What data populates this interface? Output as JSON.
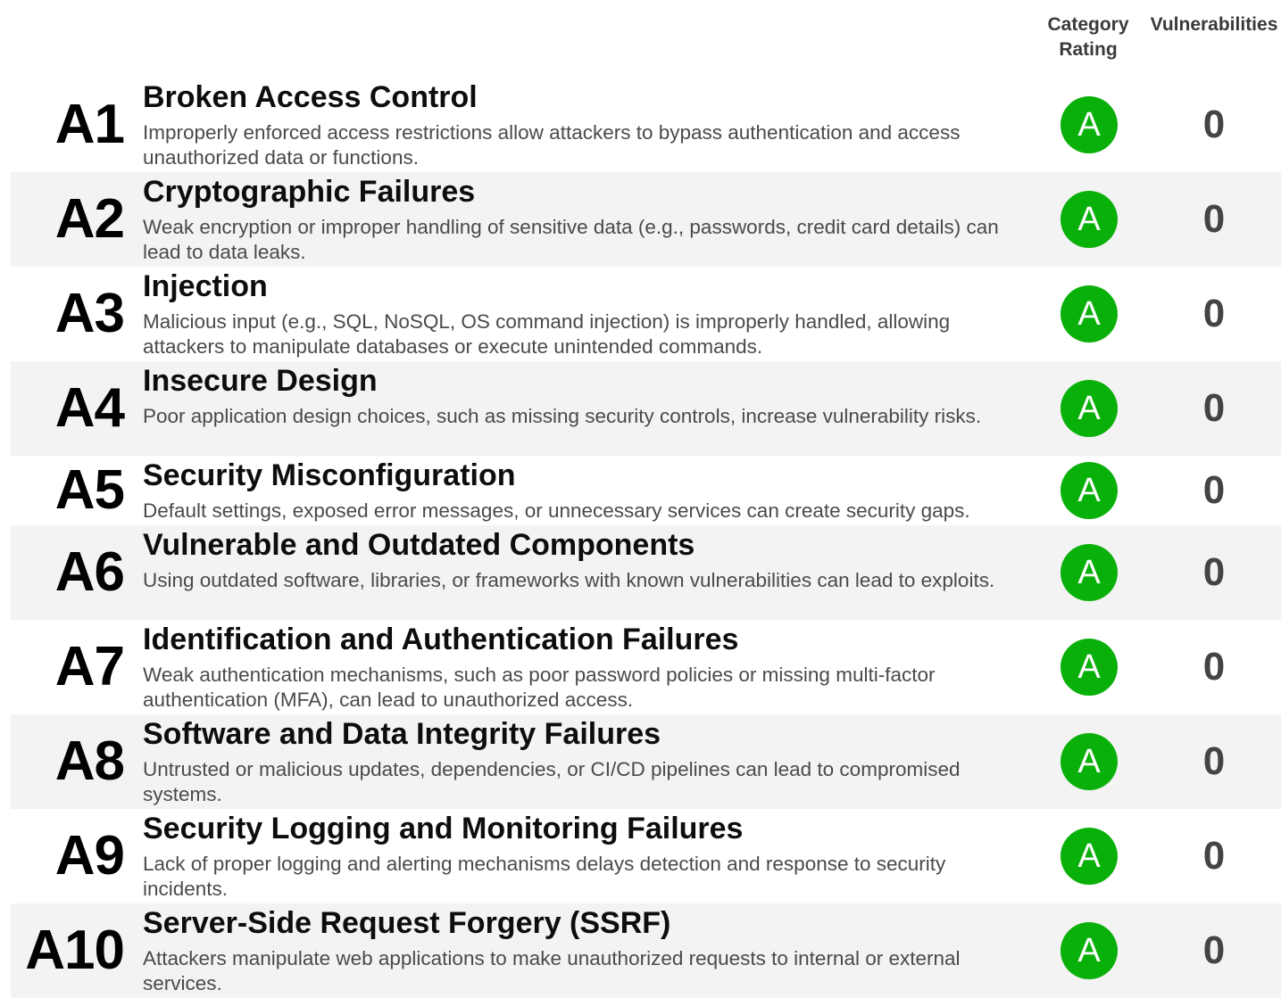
{
  "headers": {
    "rating": "Category\nRating",
    "vulnerabilities": "Vulnerabilities"
  },
  "colors": {
    "rating_badge": "#0ab00a",
    "row_alt_bg": "#f3f3f3"
  },
  "rows": [
    {
      "code": "A1",
      "title": "Broken Access Control",
      "description": "Improperly enforced access restrictions allow attackers to bypass authentication and access unauthorized data or functions.",
      "rating": "A",
      "vulnerabilities": "0"
    },
    {
      "code": "A2",
      "title": "Cryptographic Failures",
      "description": "Weak encryption or improper handling of sensitive data (e.g., passwords, credit card details) can lead to data leaks.",
      "rating": "A",
      "vulnerabilities": "0"
    },
    {
      "code": "A3",
      "title": "Injection",
      "description": "Malicious input (e.g., SQL, NoSQL, OS command injection) is improperly handled, allowing attackers to manipulate databases or execute unintended commands.",
      "rating": "A",
      "vulnerabilities": "0"
    },
    {
      "code": "A4",
      "title": "Insecure Design",
      "description": "Poor application design choices, such as missing security controls, increase vulnerability risks.",
      "rating": "A",
      "vulnerabilities": "0"
    },
    {
      "code": "A5",
      "title": "Security Misconfiguration",
      "description": "Default settings, exposed error messages, or unnecessary services can create security gaps.",
      "rating": "A",
      "vulnerabilities": "0"
    },
    {
      "code": "A6",
      "title": "Vulnerable and Outdated Components",
      "description": "Using outdated software, libraries, or frameworks with known vulnerabilities can lead to exploits.",
      "rating": "A",
      "vulnerabilities": "0"
    },
    {
      "code": "A7",
      "title": "Identification and Authentication Failures",
      "description": "Weak authentication mechanisms, such as poor password policies or missing multi-factor authentication (MFA), can lead to unauthorized access.",
      "rating": "A",
      "vulnerabilities": "0"
    },
    {
      "code": "A8",
      "title": "Software and Data Integrity Failures",
      "description": "Untrusted or malicious updates, dependencies, or CI/CD pipelines can lead to compromised systems.",
      "rating": "A",
      "vulnerabilities": "0"
    },
    {
      "code": "A9",
      "title": "Security Logging and Monitoring Failures",
      "description": "Lack of proper logging and alerting mechanisms delays detection and response to security incidents.",
      "rating": "A",
      "vulnerabilities": "0"
    },
    {
      "code": "A10",
      "title": "Server-Side Request Forgery (SSRF)",
      "description": "Attackers manipulate web applications to make unauthorized requests to internal or external services.",
      "rating": "A",
      "vulnerabilities": "0"
    }
  ]
}
